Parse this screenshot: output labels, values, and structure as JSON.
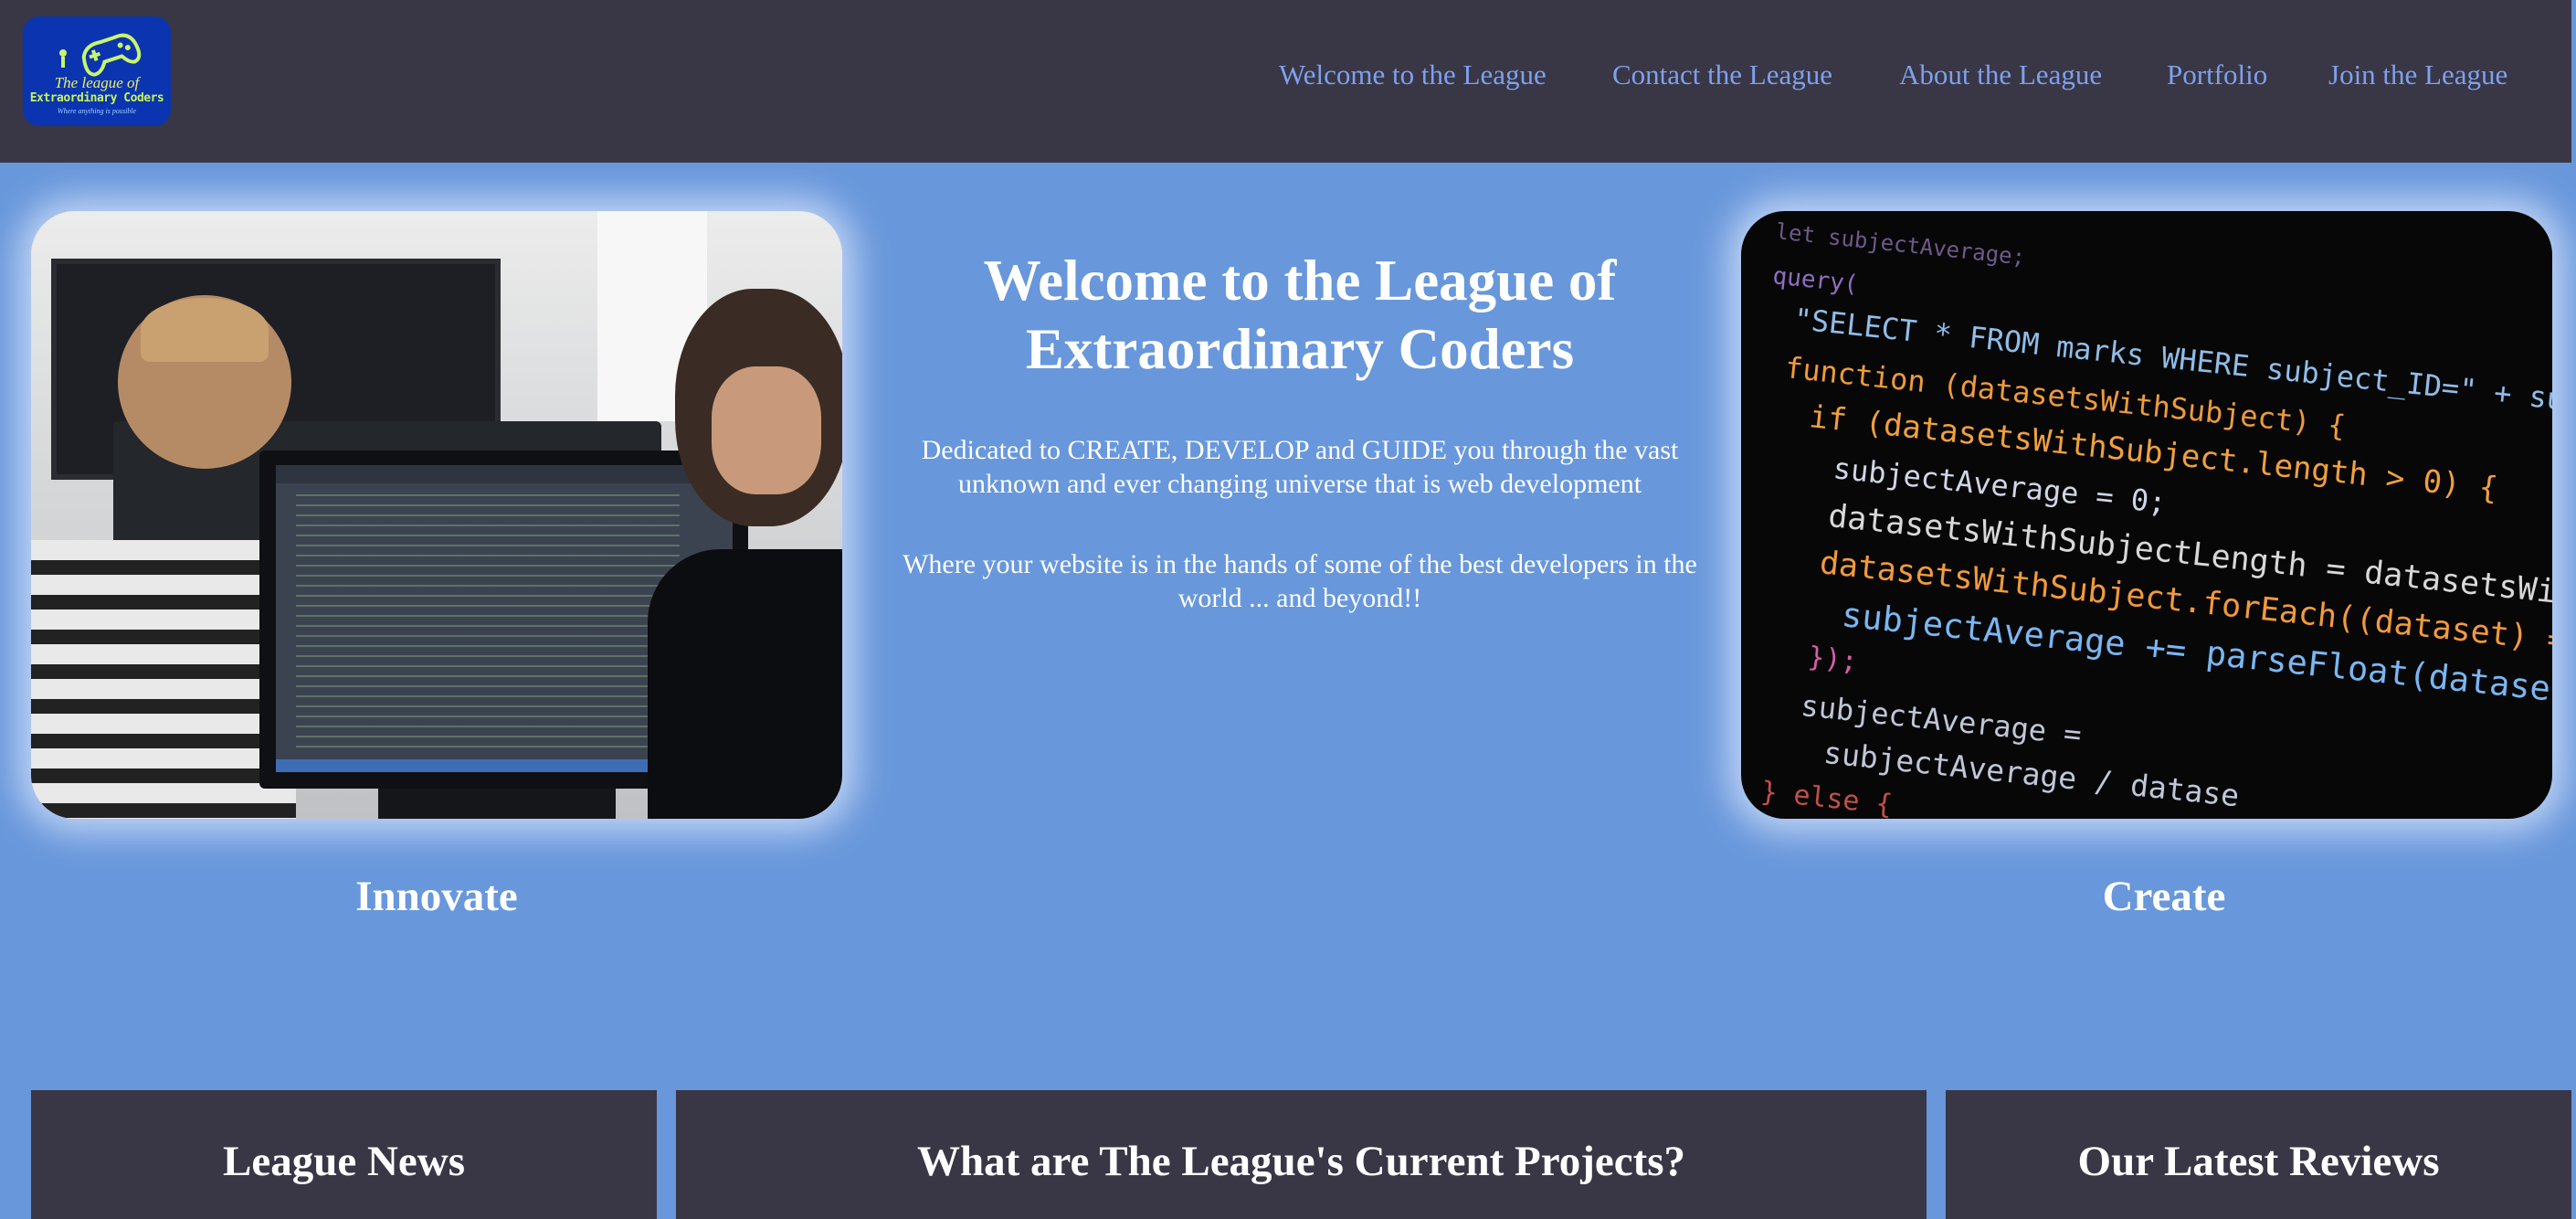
{
  "logo": {
    "line1": "The league of",
    "line2": "Extraordinary Coders",
    "line3": "Where anything is possible"
  },
  "nav": {
    "items": [
      {
        "label": "Welcome to the League"
      },
      {
        "label": "Contact the League"
      },
      {
        "label": "About the League"
      },
      {
        "label": "Portfolio"
      },
      {
        "label": "Join the League"
      }
    ]
  },
  "hero": {
    "title": "Welcome to the League of Extraordinary Coders",
    "paragraph1": "Dedicated to CREATE, DEVELOP and GUIDE you through the vast unknown and ever changing universe that is web development",
    "paragraph2": "Where your website is in the hands of some of the best developers in the world ... and beyond!!"
  },
  "captions": {
    "left": "Innovate",
    "right": "Create"
  },
  "code_image": {
    "lines": [
      "let subjectAverage;",
      "query(",
      "\"SELECT * FROM marks WHERE subject_ID=\" + subject",
      "function (datasetsWithSubject) {",
      "if (datasetsWithSubject.length > 0) {",
      "subjectAverage = 0;",
      "datasetsWithSubjectLength = datasetsWithSu",
      "datasetsWithSubject.forEach((dataset) => {",
      "subjectAverage += parseFloat(dataset[\"",
      "});",
      "subjectAverage =",
      "subjectAverage / datase",
      "} else {"
    ]
  },
  "panels": {
    "news": "League News",
    "projects": "What are The League's Current Projects?",
    "reviews": "Our Latest Reviews"
  },
  "colors": {
    "page_background": "#6897db",
    "header_background": "#393646",
    "nav_link": "#7ea1ea",
    "panel_background": "#393646",
    "text": "#ffffff"
  },
  "icons": {
    "logo_mark": "gamepad-icon"
  }
}
